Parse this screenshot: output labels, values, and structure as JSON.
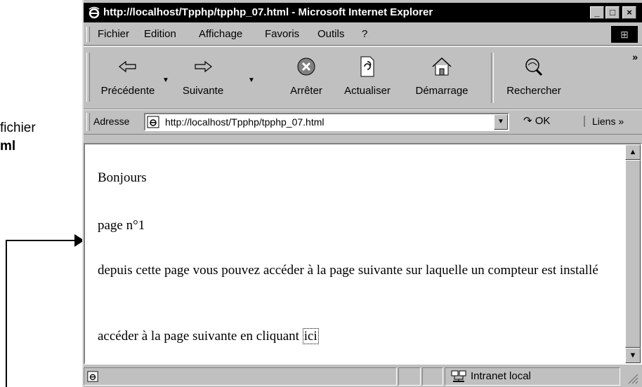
{
  "annotation": {
    "line1": "fichier",
    "line2": "ml"
  },
  "window": {
    "title": "http://localhost/Tpphp/tpphp_07.html - Microsoft Internet Explorer",
    "min_label": "_",
    "max_label": "□",
    "close_label": "×"
  },
  "menu": {
    "items": [
      {
        "label": "Fichier"
      },
      {
        "label": "Edition"
      },
      {
        "label": "Affichage"
      },
      {
        "label": "Favoris"
      },
      {
        "label": "Outils"
      },
      {
        "label": "?"
      }
    ]
  },
  "toolbar": {
    "back": "Précédente",
    "forward": "Suivante",
    "stop": "Arrêter",
    "refresh": "Actualiser",
    "home": "Démarrage",
    "search": "Rechercher",
    "more": "»"
  },
  "address": {
    "label": "Adresse",
    "url": "http://localhost/Tpphp/tpphp_07.html",
    "go": "OK",
    "links": "Liens »"
  },
  "page": {
    "line1": "Bonjours",
    "line2": "page n°1",
    "para1": "depuis cette page vous pouvez accéder à la page suivante sur laquelle un compteur est installé",
    "para2": "accéder à la page suivante en cliquant",
    "link": "ici"
  },
  "status": {
    "zone": "Intranet local"
  }
}
